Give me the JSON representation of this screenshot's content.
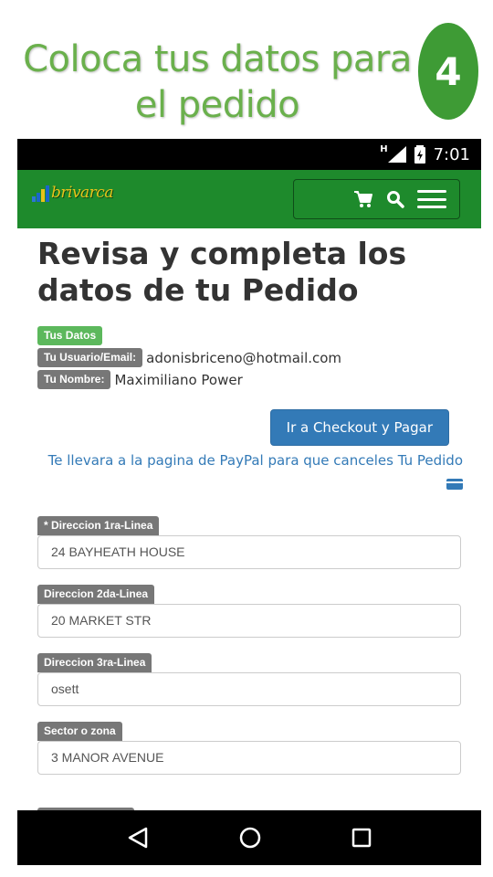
{
  "slide": {
    "title": "Coloca tus datos para el pedido",
    "step": "4"
  },
  "status_bar": {
    "network": "H",
    "time": "7:01"
  },
  "header": {
    "logo_text": "brivarca",
    "icons": [
      "cart-icon",
      "search-icon",
      "menu-icon"
    ]
  },
  "page": {
    "title": "Revisa y completa los datos de tu Pedido",
    "section_label": "Tus Datos",
    "user_label": "Tu Usuario/Email:",
    "user_value": "adonisbriceno@hotmail.com",
    "name_label": "Tu Nombre:",
    "name_value": "Maximiliano Power",
    "checkout_button": "Ir a Checkout y Pagar",
    "paypal_note": "Te llevara a la pagina de PayPal para que canceles Tu Pedido"
  },
  "fields": [
    {
      "label": "* Direccion 1ra-Linea",
      "value": "24 BAYHEATH HOUSE"
    },
    {
      "label": "Direccion 2da-Linea",
      "value": "20 MARKET STR"
    },
    {
      "label": "Direccion 3ra-Linea",
      "value": "osett"
    },
    {
      "label": "Sector o zona",
      "value": "3 MANOR AVENUE"
    }
  ],
  "nav": {
    "buttons": [
      "back-icon",
      "home-icon",
      "recents-icon"
    ]
  },
  "colors": {
    "slide_green": "#6ab04c",
    "badge_green": "#3e9b35",
    "navbar_green": "#1e8a2c",
    "primary_blue": "#337ab7",
    "label_gray": "#777777",
    "label_success": "#5cb85c"
  }
}
